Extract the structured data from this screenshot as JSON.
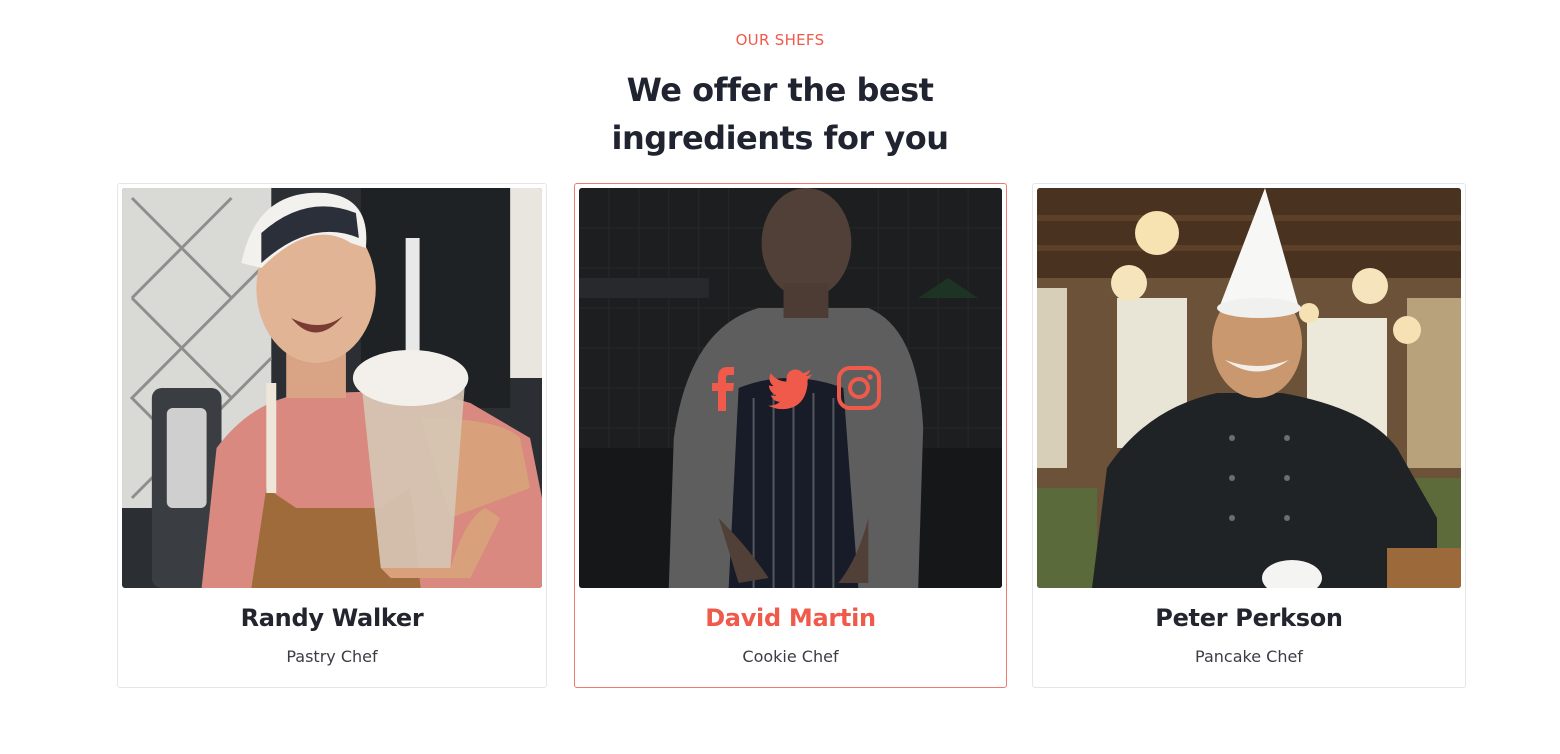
{
  "section": {
    "eyebrow": "OUR SHEFS",
    "heading_line1": "We offer the best",
    "heading_line2": "ingredients for you"
  },
  "chefs": [
    {
      "name": "Randy Walker",
      "role": "Pastry Chef"
    },
    {
      "name": "David Martin",
      "role": "Cookie Chef",
      "active": true,
      "socials": [
        "facebook-icon",
        "twitter-icon",
        "instagram-icon"
      ]
    },
    {
      "name": "Peter Perkson",
      "role": "Pancake Chef"
    }
  ],
  "colors": {
    "accent": "#ef5a4a",
    "heading": "#1f2430",
    "active_border": "#ef7a6e"
  }
}
